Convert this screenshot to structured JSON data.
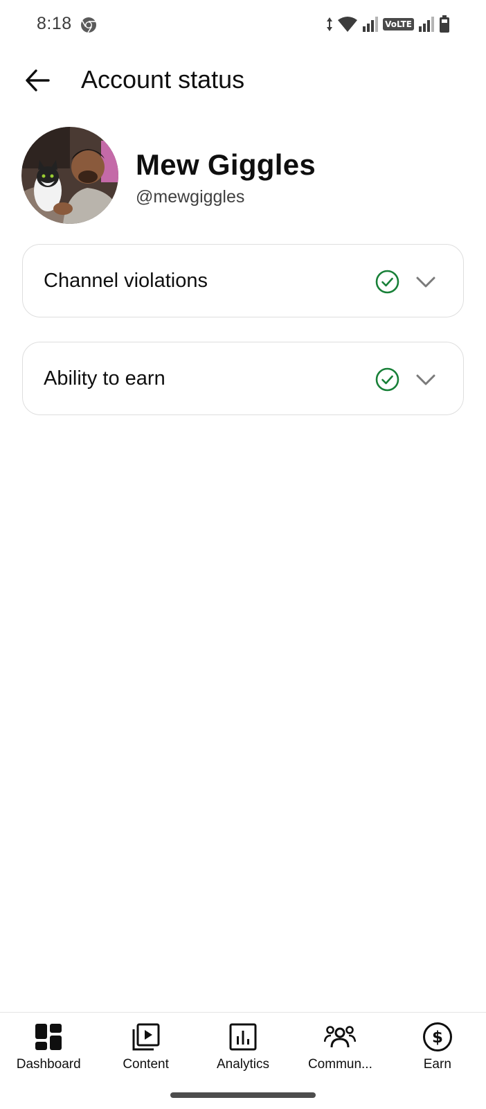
{
  "status_bar": {
    "time": "8:18",
    "network_label": "VoLTE",
    "icons": [
      "chrome-icon",
      "data-arrows-icon",
      "wifi-icon",
      "signal-icon",
      "signal-icon",
      "battery-icon"
    ]
  },
  "header": {
    "back_icon": "arrow-left-icon",
    "title": "Account status"
  },
  "profile": {
    "name": "Mew Giggles",
    "handle": "@mewgiggles"
  },
  "cards": [
    {
      "label": "Channel violations",
      "status": "ok",
      "status_icon": "check-circle-icon",
      "expand_icon": "chevron-down-icon"
    },
    {
      "label": "Ability to earn",
      "status": "ok",
      "status_icon": "check-circle-icon",
      "expand_icon": "chevron-down-icon"
    }
  ],
  "bottom_nav": {
    "items": [
      {
        "label": "Dashboard",
        "icon": "dashboard-icon"
      },
      {
        "label": "Content",
        "icon": "content-icon"
      },
      {
        "label": "Analytics",
        "icon": "analytics-icon"
      },
      {
        "label": "Commun...",
        "icon": "community-icon"
      },
      {
        "label": "Earn",
        "icon": "earn-icon"
      }
    ]
  },
  "colors": {
    "check_green": "#188038",
    "chevron_gray": "#7a7a7a",
    "text_primary": "#0f0f0f",
    "card_border": "#dedede"
  }
}
